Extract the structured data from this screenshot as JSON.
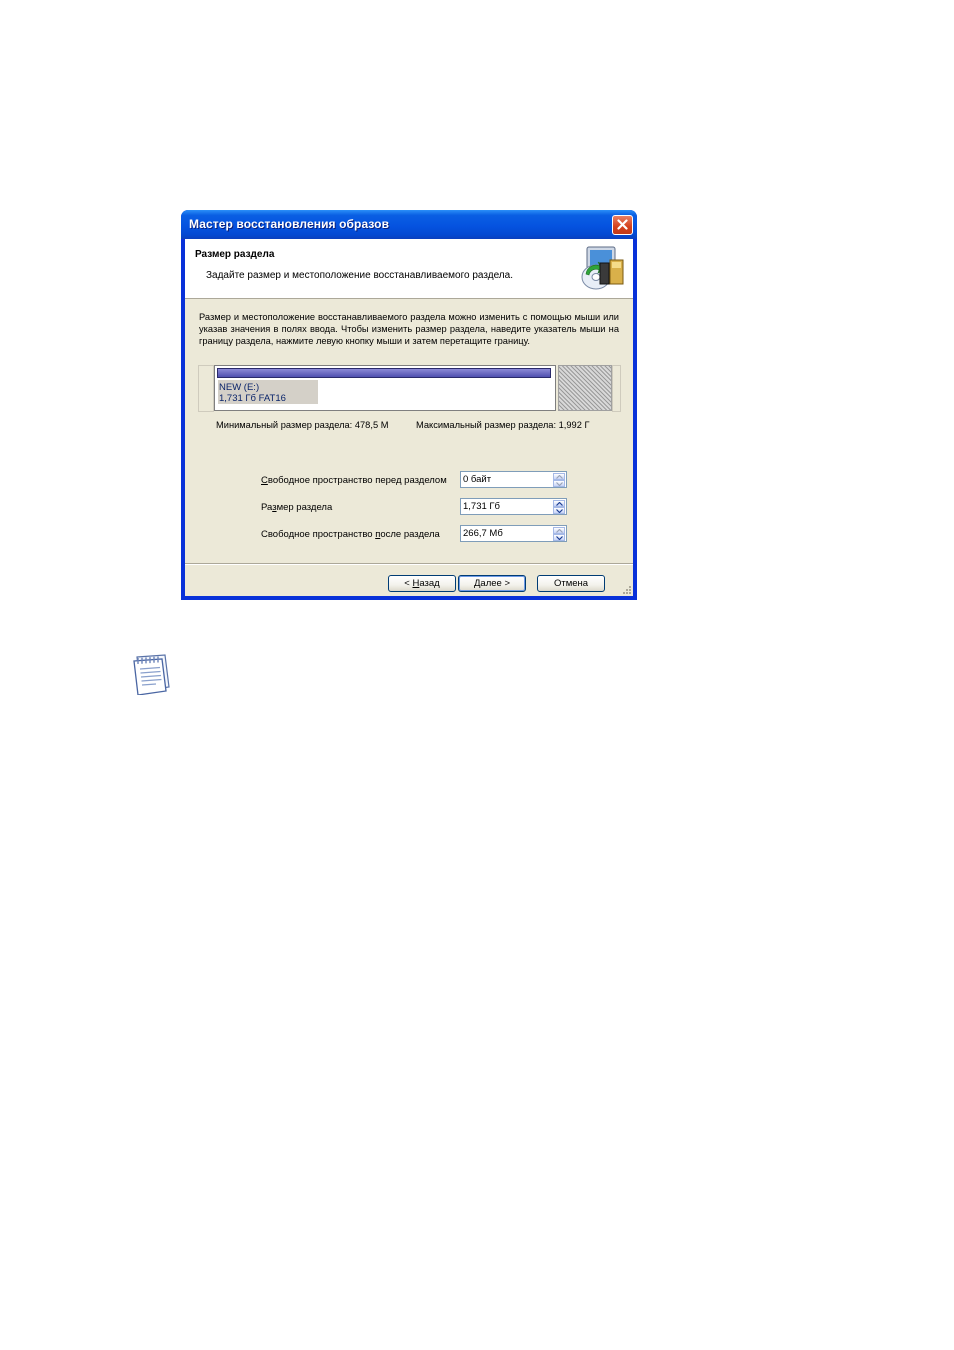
{
  "window": {
    "title": "Мастер восстановления образов",
    "close_icon": "close-icon"
  },
  "header": {
    "title": "Размер раздела",
    "subtitle": "Задайте размер и местоположение восстанавливаемого раздела.",
    "icon": "restore-wizard-icon"
  },
  "description": "Размер и местоположение восстанавливаемого раздела можно изменить с помощью мыши или указав значения в полях ввода. Чтобы изменить размер раздела, наведите указатель мыши на границу раздела, нажмите левую кнопку мыши и затем перетащите границу.",
  "partition": {
    "name": "NEW (E:)",
    "size_fs": "1,731 Гб  FAT16"
  },
  "limits": {
    "min": "Минимальный размер раздела: 478,5 М",
    "max": "Максимальный размер раздела: 1,992 Г"
  },
  "fields": {
    "before_label_pre": "",
    "before_label_u": "С",
    "before_label_post": "вободное пространство перед разделом",
    "before_value": "0 байт",
    "size_label_pre": "Ра",
    "size_label_u": "з",
    "size_label_post": "мер раздела",
    "size_value": "1,731 Гб",
    "after_label_pre": "Свободное пространство ",
    "after_label_u": "п",
    "after_label_post": "осле раздела",
    "after_value": "266,7 Мб"
  },
  "buttons": {
    "back_pre": "< ",
    "back_u": "Н",
    "back_post": "азад",
    "next_pre": "",
    "next_u": "Д",
    "next_post": "алее >",
    "cancel": "Отмена"
  },
  "note_icon": "note-icon"
}
